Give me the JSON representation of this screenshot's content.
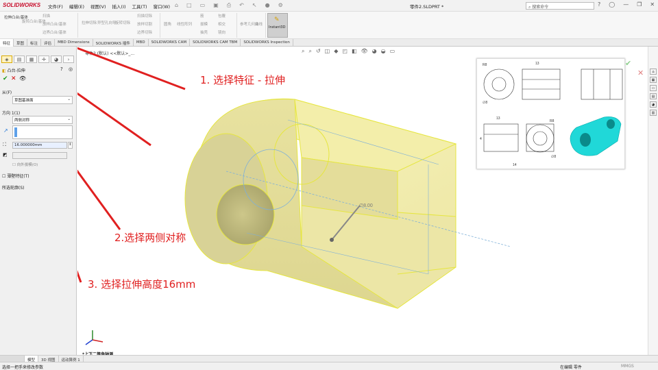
{
  "app": {
    "logo": "SOLIDWORKS",
    "doc_title": "零件2.SLDPRT *"
  },
  "menus": [
    "文件(F)",
    "编辑(E)",
    "视图(V)",
    "插入(I)",
    "工具(T)",
    "窗口(W)"
  ],
  "search": {
    "placeholder": "搜索命令"
  },
  "ribbon": {
    "buttons": [
      "拉伸凸台/基体",
      "旋转凸台/基体",
      "扫描",
      "放样凸台/基体",
      "边界凸台/基体",
      "拉伸切除",
      "异型孔向导",
      "旋转切除",
      "扫描切除",
      "放样切割",
      "边界切除",
      "圆角",
      "线性阵列",
      "筋",
      "拔模",
      "抽壳",
      "包覆",
      "相交",
      "镜向",
      "参考几何体",
      "曲线",
      "Instant3D"
    ]
  },
  "tabs": [
    "特征",
    "草图",
    "标注",
    "评估",
    "MBD Dimensions",
    "SOLIDWORKS 插件",
    "MBD",
    "SOLIDWORKS CAM",
    "SOLIDWORKS CAM TBM",
    "SOLIDWORKS Inspection"
  ],
  "breadcrumb": "零件2 (默认) <<默认>_...",
  "panel": {
    "title": "凸台-拉伸",
    "from_label": "从(F)",
    "from_value": "草图基准面",
    "dir1_label": "方向 1(1)",
    "dir1_type": "两侧对称",
    "depth": "16.000000mm",
    "draft_label": "向外拔模(O)",
    "thin_label": "薄壁特征(T)",
    "contours_label": "所选轮廓(S)"
  },
  "dim_label": "∅8.00",
  "annotations": {
    "a1": "1. 选择特征 - 拉伸",
    "a2": "2.选择两侧对称",
    "a3": "3. 选择拉伸高度16mm"
  },
  "drawing": {
    "dims": [
      "R8",
      "13",
      "∅8",
      "13",
      "R8",
      "4",
      "14",
      "∅8"
    ]
  },
  "view_label": "*上下二等角轴测",
  "bottom_tabs": [
    "模型",
    "3D 视图",
    "运动算例 1"
  ],
  "status": {
    "left": "选择一把手来修改参数",
    "right1": "在编辑 零件",
    "right2": "MMGS"
  },
  "colors": {
    "accent": "#e02020",
    "body": "#f3eeaa",
    "edge": "#e6e640",
    "cyan": "#20d8d8"
  }
}
